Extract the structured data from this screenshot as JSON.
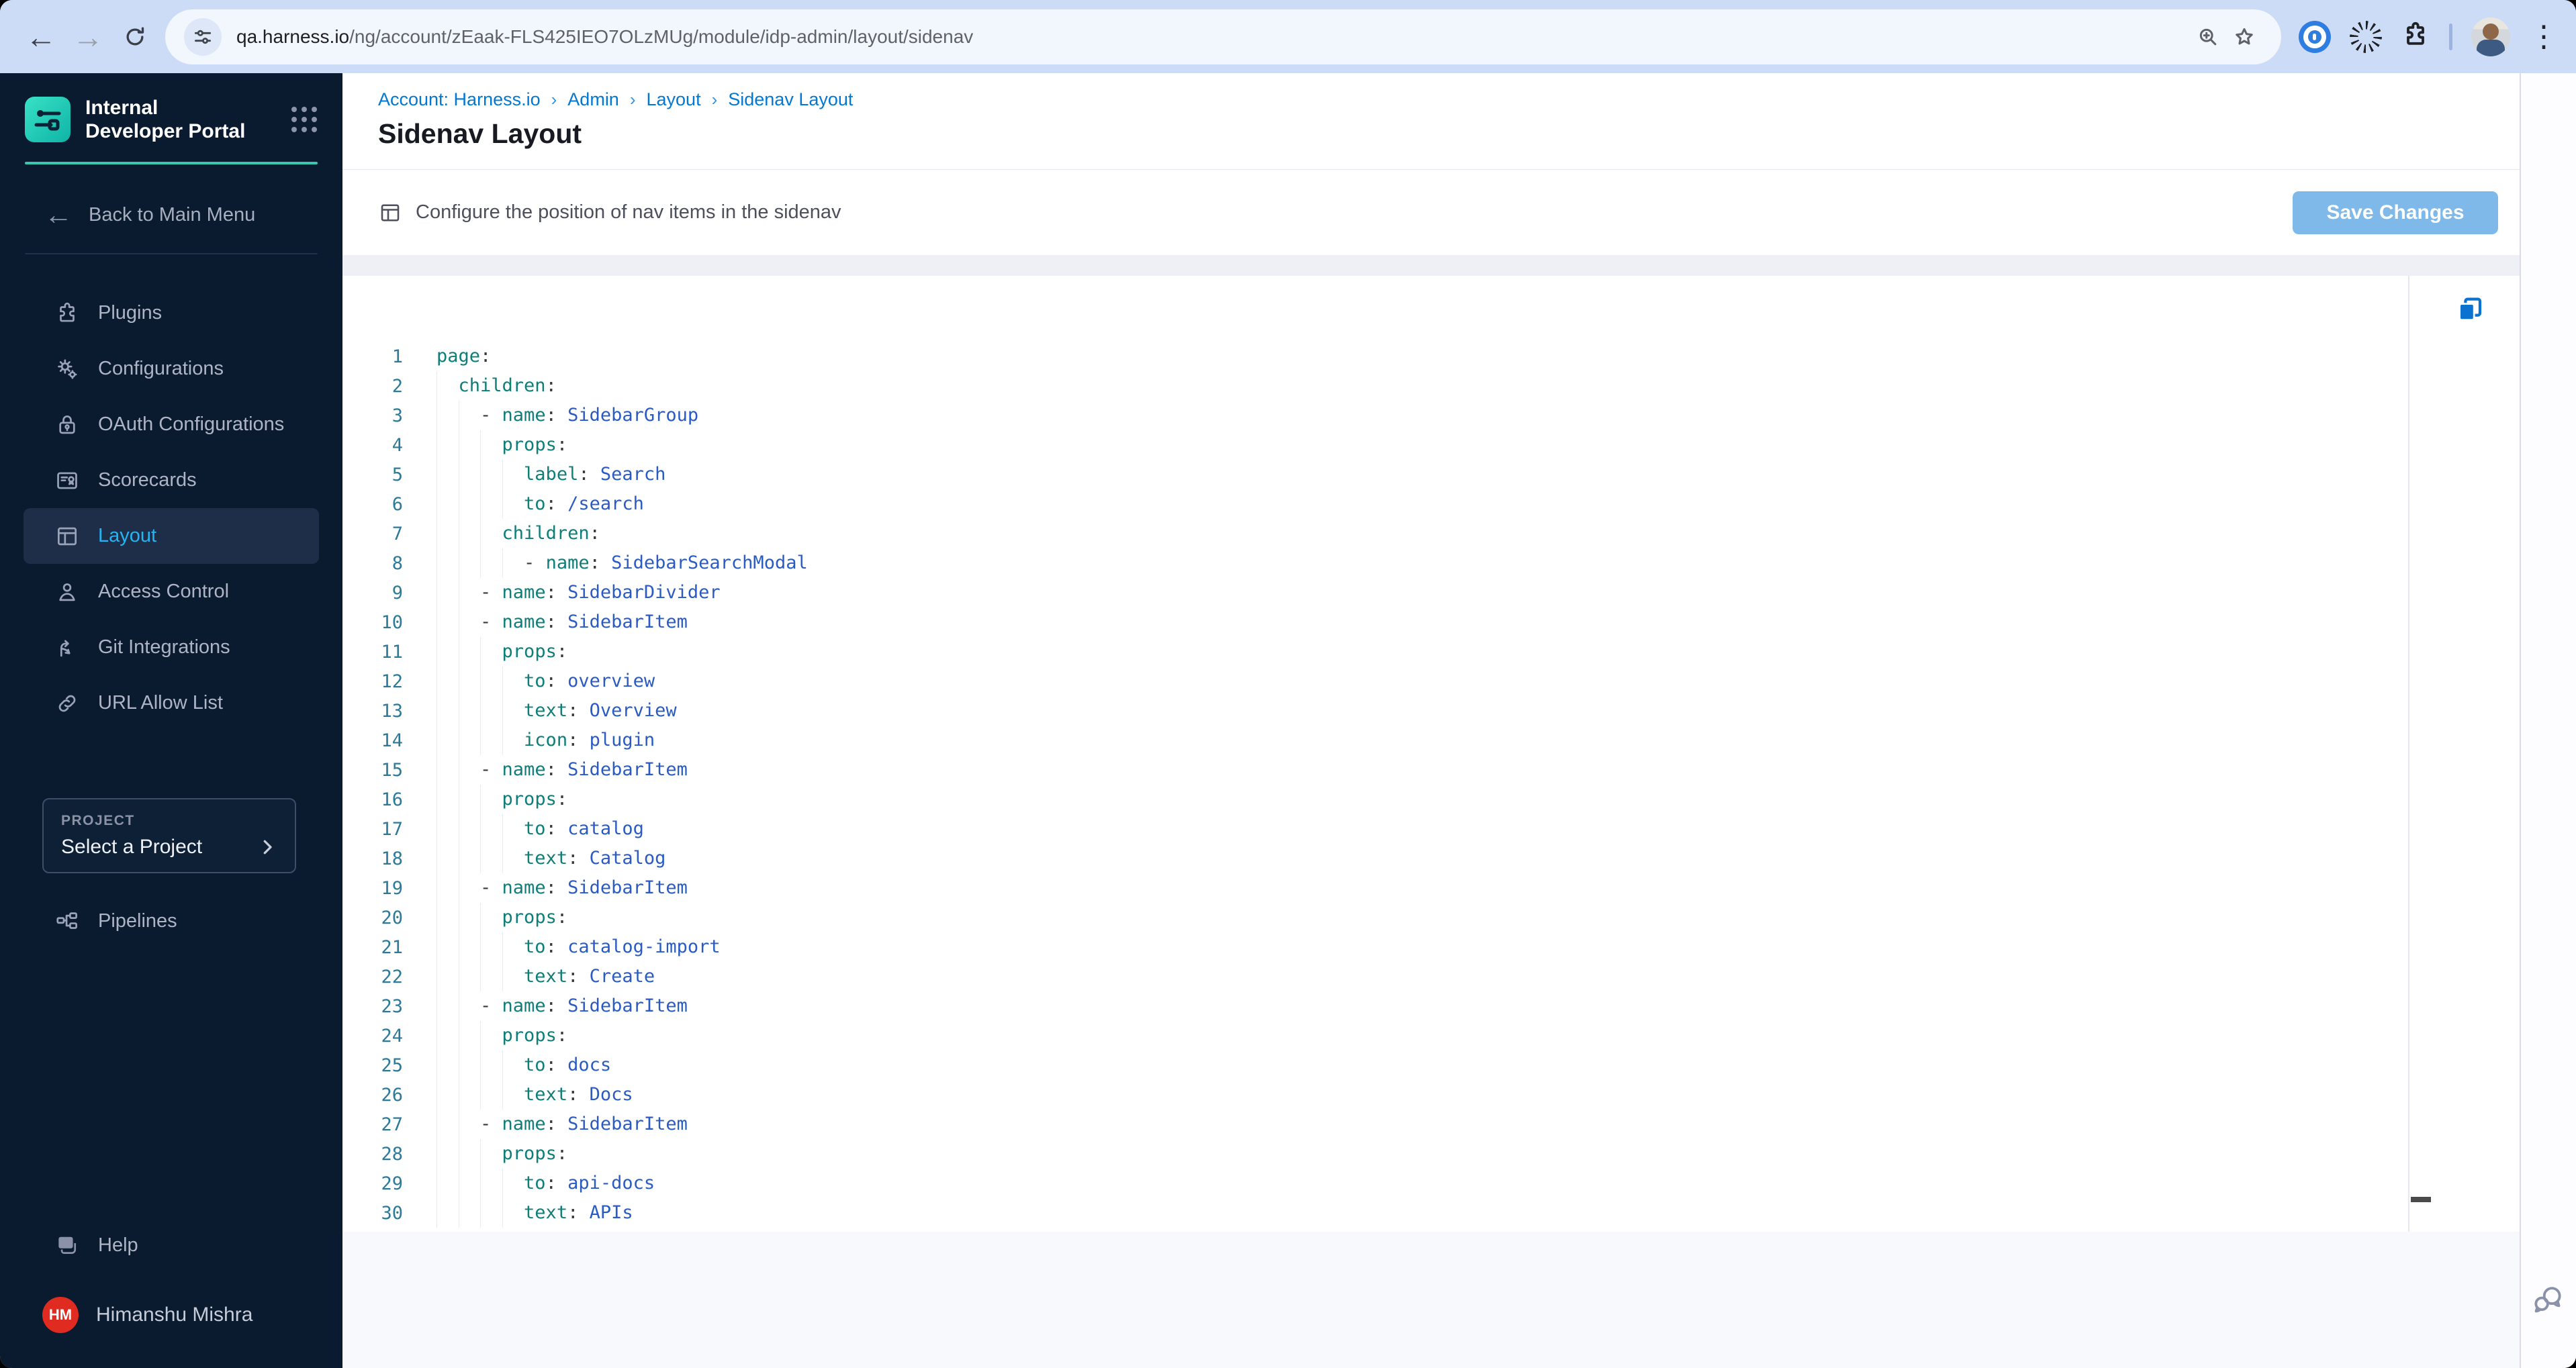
{
  "browser": {
    "url_domain": "qa.harness.io",
    "url_path": "/ng/account/zEaak-FLS425IEO7OLzMUg/module/idp-admin/layout/sidenav"
  },
  "sidebar": {
    "product_title": "Internal Developer Portal",
    "back_label": "Back to Main Menu",
    "items": [
      {
        "label": "Plugins",
        "icon": "plugin-icon",
        "active": false
      },
      {
        "label": "Configurations",
        "icon": "gear-icon",
        "active": false
      },
      {
        "label": "OAuth Configurations",
        "icon": "lock-icon",
        "active": false
      },
      {
        "label": "Scorecards",
        "icon": "scorecard-icon",
        "active": false
      },
      {
        "label": "Layout",
        "icon": "layout-icon",
        "active": true
      },
      {
        "label": "Access Control",
        "icon": "person-icon",
        "active": false
      },
      {
        "label": "Git Integrations",
        "icon": "git-branch-icon",
        "active": false
      },
      {
        "label": "URL Allow List",
        "icon": "link-icon",
        "active": false
      }
    ],
    "project": {
      "label": "PROJECT",
      "value": "Select a Project"
    },
    "pipelines_label": "Pipelines",
    "help_label": "Help",
    "user": {
      "initials": "HM",
      "name": "Himanshu Mishra"
    }
  },
  "header": {
    "breadcrumb": [
      "Account: Harness.io",
      "Admin",
      "Layout",
      "Sidenav Layout"
    ],
    "title": "Sidenav Layout"
  },
  "toolbar": {
    "description": "Configure the position of nav items in the sidenav",
    "save_label": "Save Changes"
  },
  "editor": {
    "language": "yaml",
    "lines": [
      "page:",
      "  children:",
      "    - name: SidebarGroup",
      "      props:",
      "        label: Search",
      "        to: /search",
      "      children:",
      "        - name: SidebarSearchModal",
      "    - name: SidebarDivider",
      "    - name: SidebarItem",
      "      props:",
      "        to: overview",
      "        text: Overview",
      "        icon: plugin",
      "    - name: SidebarItem",
      "      props:",
      "        to: catalog",
      "        text: Catalog",
      "    - name: SidebarItem",
      "      props:",
      "        to: catalog-import",
      "        text: Create",
      "    - name: SidebarItem",
      "      props:",
      "        to: docs",
      "        text: Docs",
      "    - name: SidebarItem",
      "      props:",
      "        to: api-docs",
      "        text: APIs"
    ]
  },
  "colors": {
    "sidebar_bg": "#0a1b2f",
    "accent_teal": "#3ac7b0",
    "active_item_blue": "#25b4f2",
    "breadcrumb_blue": "#0278d5",
    "save_button_bg": "#7eb9ea",
    "code_key": "#0d7e78",
    "code_value": "#2a5bc4",
    "line_number": "#2b7a99",
    "avatar_red": "#e02b20",
    "copy_icon_blue": "#0b72d0"
  }
}
